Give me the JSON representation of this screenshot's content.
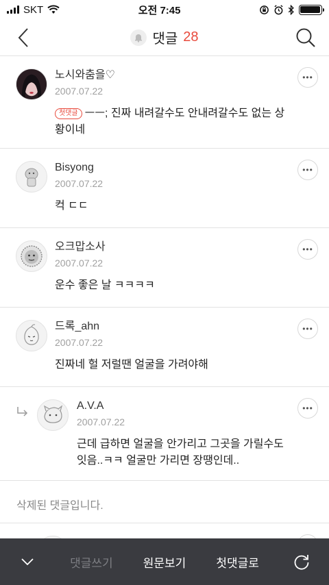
{
  "status_bar": {
    "carrier": "SKT",
    "time": "오전 7:45"
  },
  "header": {
    "title": "댓글",
    "count": "28"
  },
  "comments": [
    {
      "author": "노시와춤을♡",
      "date": "2007.07.22",
      "badge": "첫댓글",
      "text": "ㅡㅡ; 진짜 내려갈수도 안내려갈수도 없는 상황이네",
      "avatar": "photo-avatar"
    },
    {
      "author": "Bisyong",
      "date": "2007.07.22",
      "text": "컥 ㄷㄷ",
      "avatar": "default-avatar"
    },
    {
      "author": "오크맙소사",
      "date": "2007.07.22",
      "text": "운수 좋은 날 ㅋㅋㅋㅋ",
      "avatar": "default-avatar"
    },
    {
      "author": "드록_ahn",
      "date": "2007.07.22",
      "text": "진짜네 헐 저럴땐 얼굴을 가려야해",
      "avatar": "default-avatar"
    },
    {
      "author": "A.V.A",
      "date": "2007.07.22",
      "text": "근데 급하면 얼굴을 안가리고 그곳을 가릴수도 잇음..ㅋㅋ 얼굴만 가리면 장땡인데..",
      "avatar": "default-avatar",
      "is_reply": true
    }
  ],
  "deleted_comment": "삭제된 댓글입니다.",
  "bottom_bar": {
    "write_label": "댓글쓰기",
    "original_label": "원문보기",
    "first_label": "첫댓글로"
  },
  "colors": {
    "accent": "#e84a3c",
    "bottom_bar": "#3a3b40"
  }
}
